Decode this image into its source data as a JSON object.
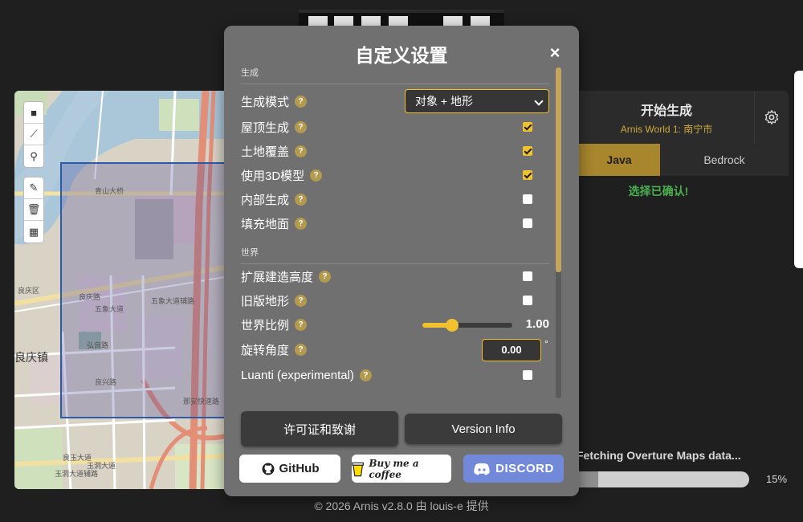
{
  "app": {
    "footer": "© 2026 Arnis v2.8.0 由 louis-e 提供"
  },
  "map": {
    "labels": {
      "road_qingshan": "青山大桥",
      "road_wuxiang": "五象大道",
      "road_wuxiang_aux": "五象大道辅路",
      "road_hongliang": "弘良路",
      "road_liangqing": "良庆路",
      "road_liangxing": "良兴路",
      "road_yuzhou": "玉洞大道",
      "road_yuzhou2": "玉洞大道辅路",
      "road_liangyu": "良玉大道",
      "district": "良庆区",
      "town": "良庆镇",
      "expressway": "那安快速路"
    },
    "tools": [
      "rectangle",
      "polyline",
      "marker",
      "edit",
      "delete",
      "layers"
    ]
  },
  "generate": {
    "title": "开始生成",
    "world": "Arnis World 1: 南宁市",
    "editions": [
      "Java",
      "Bedrock"
    ],
    "selected_edition": "Java",
    "confirm": "选择已确认!"
  },
  "progress": {
    "message": "Fetching Overture Maps data...",
    "percent_label": "15%",
    "fraction": 0.15
  },
  "modal": {
    "title": "自定义设置",
    "close": "×",
    "section_generate": "生成",
    "section_world": "世界",
    "help": "?",
    "rows": {
      "mode": {
        "label": "生成模式",
        "value": "对象 + 地形"
      },
      "roof": {
        "label": "屋顶生成",
        "checked": true
      },
      "landcover": {
        "label": "土地覆盖",
        "checked": true
      },
      "models3d": {
        "label": "使用3D模型",
        "checked": true
      },
      "interior": {
        "label": "内部生成",
        "checked": false
      },
      "fill_ground": {
        "label": "填充地面",
        "checked": false
      },
      "extend_height": {
        "label": "扩展建造高度",
        "checked": false
      },
      "legacy_terrain": {
        "label": "旧版地形",
        "checked": false
      },
      "world_scale": {
        "label": "世界比例",
        "value": "1.00",
        "fraction": 0.33
      },
      "rotation": {
        "label": "旋转角度",
        "value": "0.00",
        "unit": "°"
      },
      "luanti": {
        "label": "Luanti (experimental)",
        "checked": false
      }
    },
    "buttons": {
      "license": "许可证和致谢",
      "version": "Version Info"
    },
    "social": {
      "github": "GitHub",
      "coffee": "Buy me a coffee",
      "discord": "DISCORD"
    }
  },
  "colors": {
    "accent": "#f2c12e",
    "success": "#4caf50",
    "modal_bg": "#707070",
    "page_bg": "#1f1f1f"
  }
}
